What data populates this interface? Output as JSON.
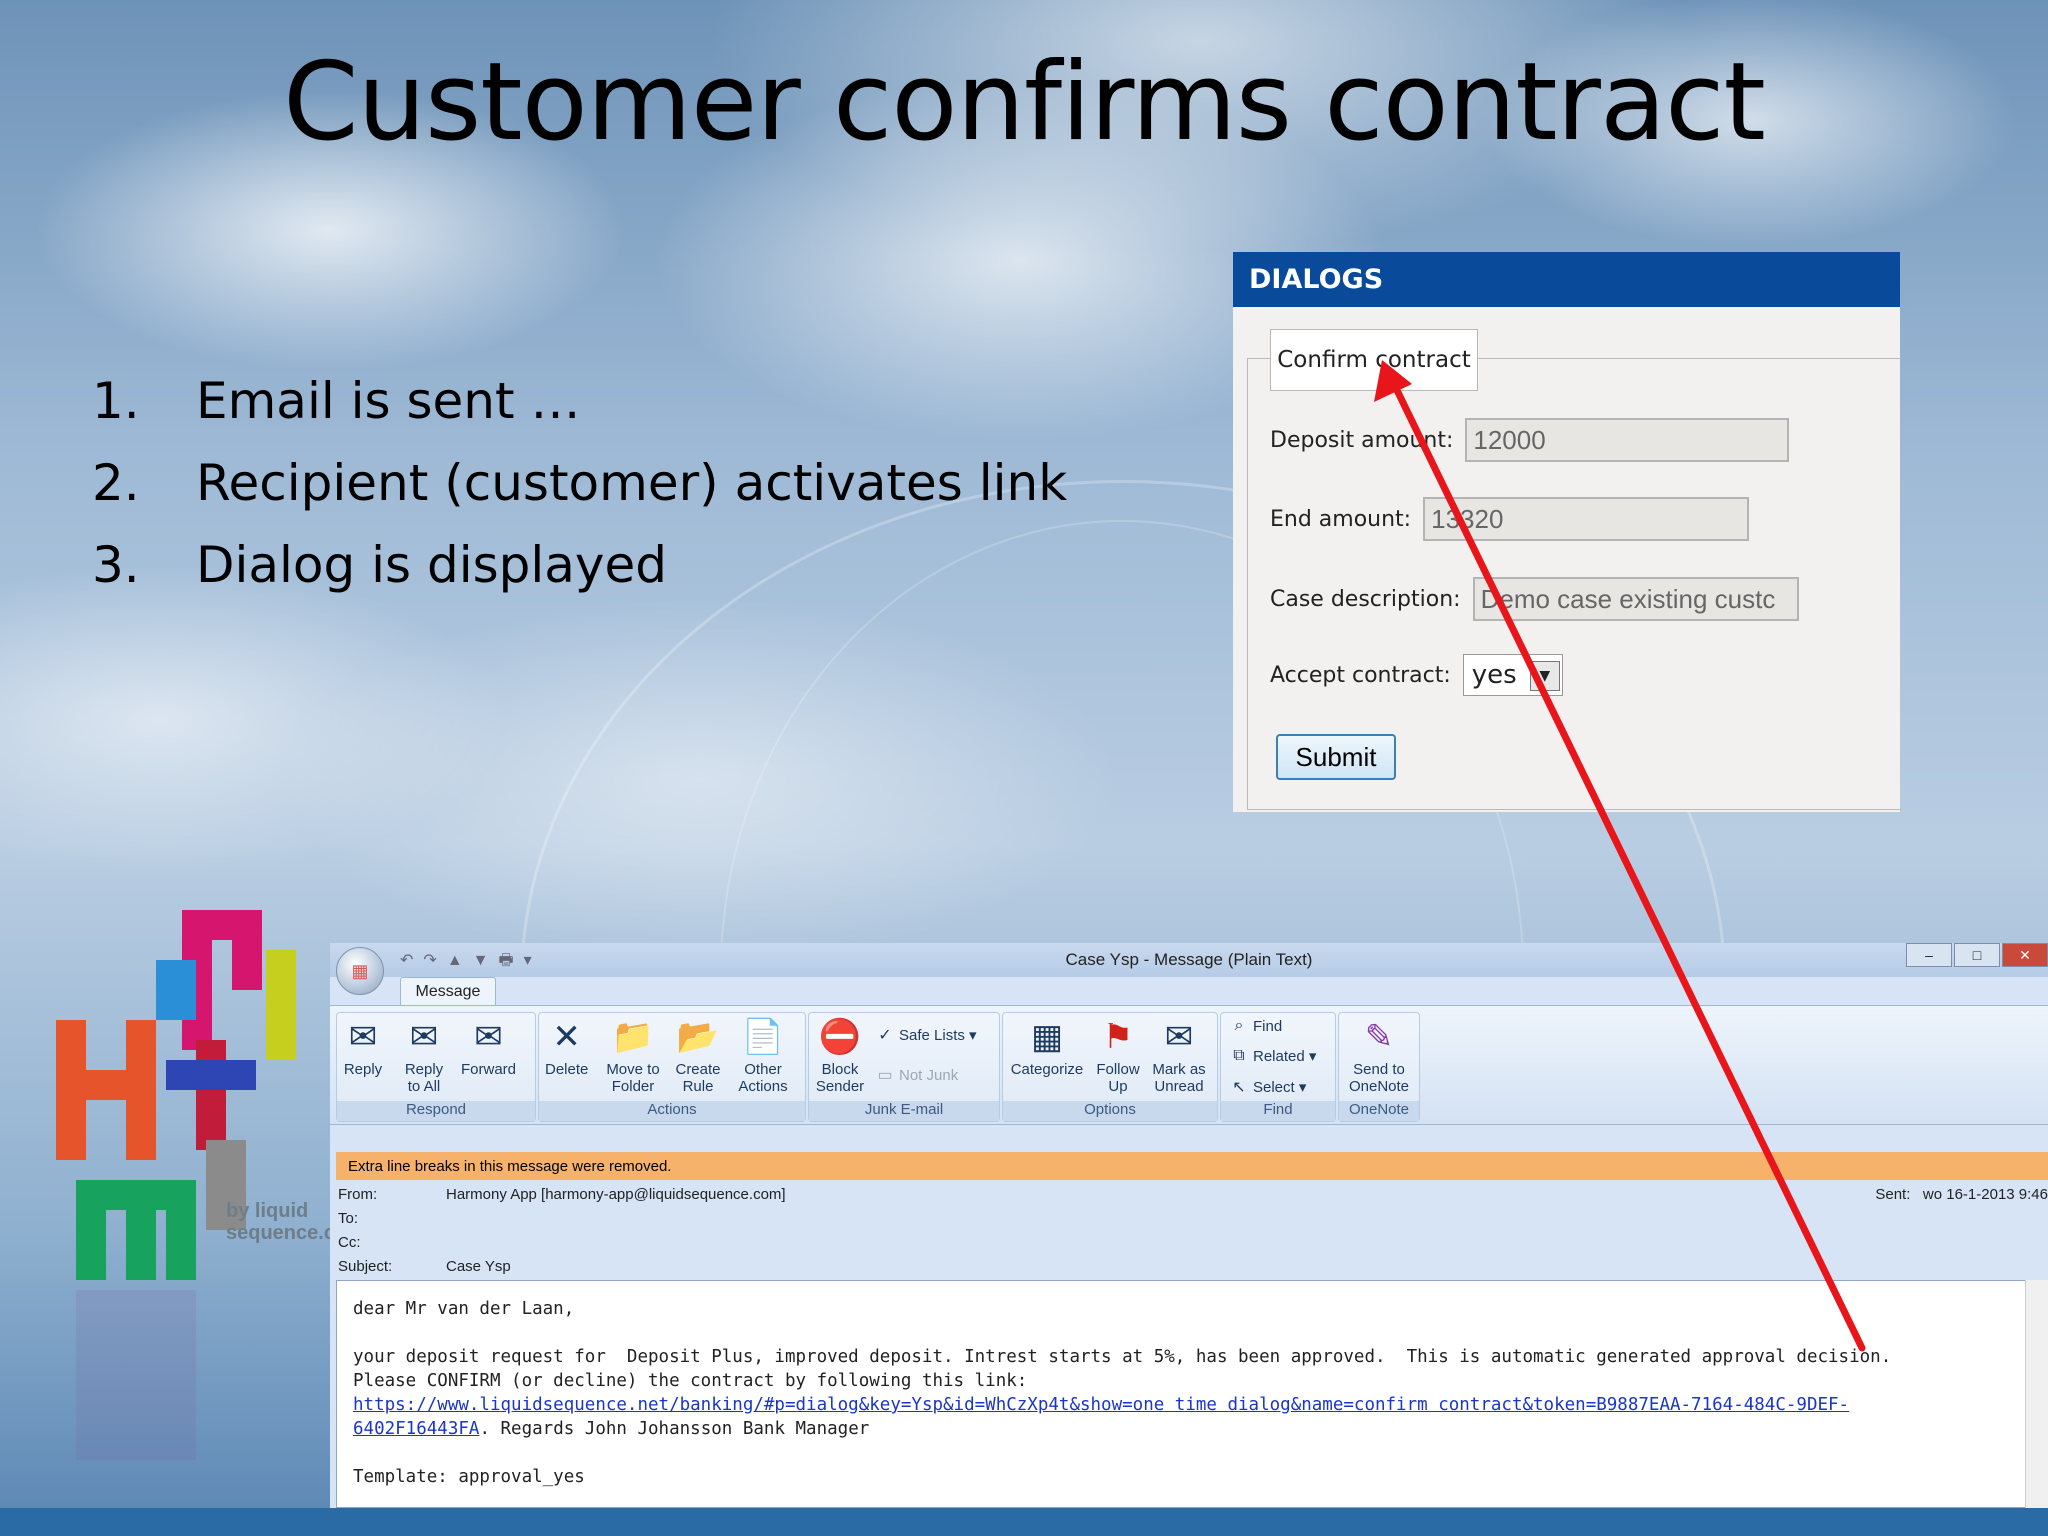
{
  "slide": {
    "title": "Customer confirms contract",
    "steps": [
      {
        "num": "1.",
        "text": "Email is sent …"
      },
      {
        "num": "2.",
        "text": "Recipient (customer) activates link"
      },
      {
        "num": "3.",
        "text": "Dialog is displayed"
      }
    ]
  },
  "dialog": {
    "header": "DIALOGS",
    "legend": "Confirm contract",
    "fields": [
      {
        "label": "Deposit amount:",
        "value": "12000"
      },
      {
        "label": "End amount:",
        "value": "13320"
      },
      {
        "label": "Case description:",
        "value": "Demo case existing custc"
      }
    ],
    "accept_label": "Accept contract:",
    "accept_value": "yes",
    "submit_label": "Submit"
  },
  "logo": {
    "text_line1": "by liquid",
    "text_line2": "sequence.c"
  },
  "outlook": {
    "window_title": "Case Ysp - Message (Plain Text)",
    "tab": "Message",
    "groups": [
      {
        "title": "Respond",
        "buttons": [
          "Reply",
          "Reply to All",
          "Forward"
        ]
      },
      {
        "title": "Actions",
        "buttons": [
          "Delete",
          "Move to Folder",
          "Create Rule",
          "Other Actions"
        ]
      },
      {
        "title": "Junk E-mail",
        "buttons": [
          "Block Sender"
        ],
        "small": [
          "Safe Lists",
          "Not Junk"
        ]
      },
      {
        "title": "Options",
        "buttons": [
          "Categorize",
          "Follow Up",
          "Mark as Unread"
        ]
      },
      {
        "title": "Find",
        "small": [
          "Find",
          "Related",
          "Select"
        ]
      },
      {
        "title": "OneNote",
        "buttons": [
          "Send to OneNote"
        ]
      }
    ],
    "infobar": "Extra line breaks in this message were removed.",
    "from_label": "From:",
    "from_value": "Harmony App [harmony-app@liquidsequence.com]",
    "to_label": "To:",
    "cc_label": "Cc:",
    "subject_label": "Subject:",
    "subject_value": "Case Ysp",
    "sent_label": "Sent:",
    "sent_value": "wo 16-1-2013 9:46",
    "body_line1": "dear Mr van der Laan,",
    "body_line2": "your deposit request for  Deposit Plus, improved deposit. Intrest starts at 5%, has been approved.  This is automatic generated approval decision.",
    "body_line3": "Please CONFIRM (or decline) the contract by following this link:",
    "body_link1": "https://www.liquidsequence.net/banking/#p=dialog&key=Ysp&id=WhCzXp4t&show=one time dialog&name=confirm contract&token=B9887EAA-7164-484C-9DEF-",
    "body_link2": "6402F16443FA",
    "body_line4": ". Regards John Johansson Bank Manager",
    "body_line5": "Template: approval_yes"
  },
  "colors": {
    "dialog_header": "#0a4a9a",
    "arrow": "#e8151b",
    "infobar": "#f6b26b"
  }
}
